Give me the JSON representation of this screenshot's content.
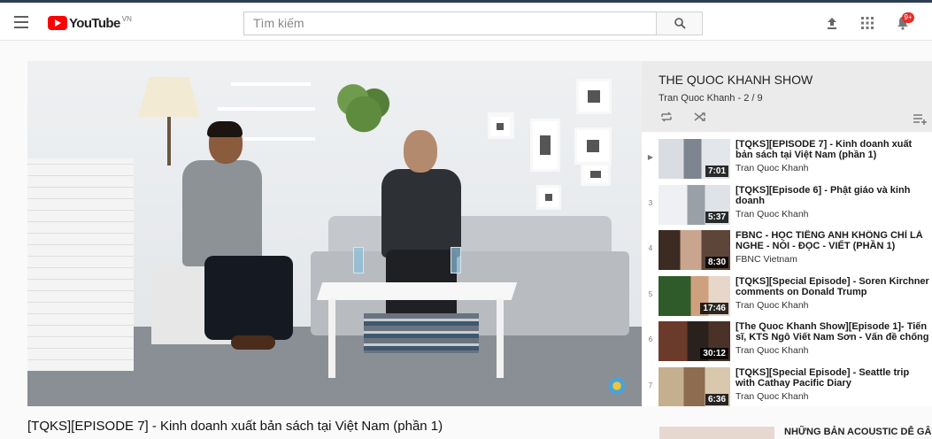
{
  "header": {
    "logo_text": "YouTube",
    "logo_region": "VN",
    "search_placeholder": "Tìm kiếm",
    "notification_count": "9+"
  },
  "playlist": {
    "title": "THE QUOC KHANH SHOW",
    "owner": "Tran Quoc Khanh",
    "position": "2 / 9",
    "current_marker": "▶",
    "items": [
      {
        "index": "",
        "title": "[TQKS][EPISODE 7] - Kinh doanh xuất bản sách tại Việt Nam (phần 1)",
        "owner": "Tran Quoc Khanh",
        "duration": "7:01"
      },
      {
        "index": "3",
        "title": "[TQKS][Episode 6] - Phật giáo và kinh doanh",
        "owner": "Tran Quoc Khanh",
        "duration": "5:37"
      },
      {
        "index": "4",
        "title": "FBNC - HỌC TIẾNG ANH KHÔNG CHỈ LÀ NGHE - NÓI - ĐỌC - VIẾT (PHẦN 1)",
        "owner": "FBNC Vietnam",
        "duration": "8:30"
      },
      {
        "index": "5",
        "title": "[TQKS][Special Episode] - Soren Kirchner comments on Donald Trump",
        "owner": "Tran Quoc Khanh",
        "duration": "17:46"
      },
      {
        "index": "6",
        "title": "[The Quoc Khanh Show][Episode 1]- Tiến sĩ, KTS Ngô Viết Nam Sơn - Vấn đề chống",
        "owner": "Tran Quoc Khanh",
        "duration": "30:12"
      },
      {
        "index": "7",
        "title": "[TQKS][Special Episode] - Seattle trip with Cathay Pacific Diary",
        "owner": "Tran Quoc Khanh",
        "duration": "6:36"
      }
    ]
  },
  "video": {
    "title": "[TQKS][EPISODE 7] - Kinh doanh xuất bản sách tại Việt Nam (phần 1)"
  },
  "recommendation": {
    "title": "NHỮNG BẢN ACOUSTIC DỄ GÂY"
  }
}
